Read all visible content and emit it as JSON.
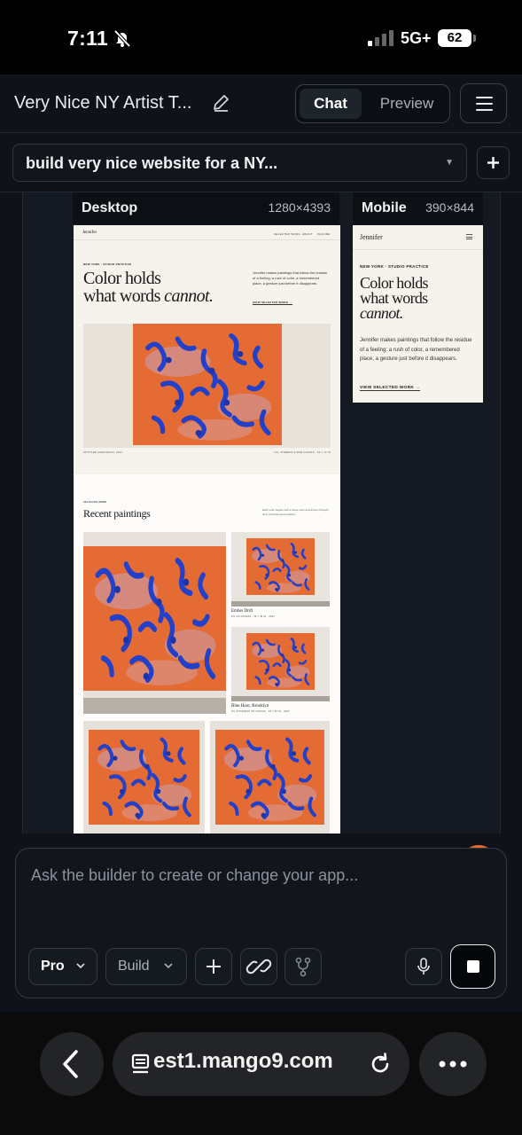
{
  "status_bar": {
    "time": "7:11",
    "network": "5G+",
    "battery": "62"
  },
  "header": {
    "project_title": "Very Nice NY Artist T...",
    "tabs": [
      {
        "label": "Chat",
        "active": true
      },
      {
        "label": "Preview",
        "active": false
      }
    ]
  },
  "conversation": {
    "selected": "build very nice website for a NY..."
  },
  "preview": {
    "desktop": {
      "label": "Desktop",
      "size": "1280×4393"
    },
    "mobile": {
      "label": "Mobile",
      "size": "390×844"
    }
  },
  "site": {
    "brand": "Jennifer",
    "nav": [
      "SELECTED WORK",
      "ABOUT",
      "INQUIRE"
    ],
    "eyebrow": "NEW YORK · STUDIO PRACTICE",
    "headline_1": "Color holds",
    "headline_2": "what words",
    "headline_em": "cannot.",
    "intro": "Jennifer makes paintings that follow the residue of a feeling: a rush of color, a remembered place, a gesture just before it disappears.",
    "cta": "VIEW SELECTED WORK →",
    "hero_caption_left": "UNTITLED (CERULEAN), 2024",
    "hero_caption_right": "OIL, PIGMENT & RAW CANVAS · 60 × 72 IN",
    "section_eyebrow": "SELECTED WORK",
    "section_title": "Recent paintings",
    "section_note": "Each work begins with a loose color and arrives through slow, physical accumulation.",
    "works": [
      {
        "title": "Ember Drift",
        "meta": "OIL ON CANVAS · 36 × 48 IN · 2024"
      },
      {
        "title": "Blue Hour, Brooklyn",
        "meta": "OIL & PIGMENT ON CANVAS · 40 × 50 IN · 2023"
      }
    ]
  },
  "composer": {
    "placeholder": "Ask the builder to create or change your app...",
    "model": "Pro",
    "mode": "Build"
  },
  "browser": {
    "url": "est1.mango9.com"
  },
  "colors": {
    "accent": "#e86a2a",
    "canvas_orange": "#e0612c",
    "brush_blue": "#2340c8"
  }
}
